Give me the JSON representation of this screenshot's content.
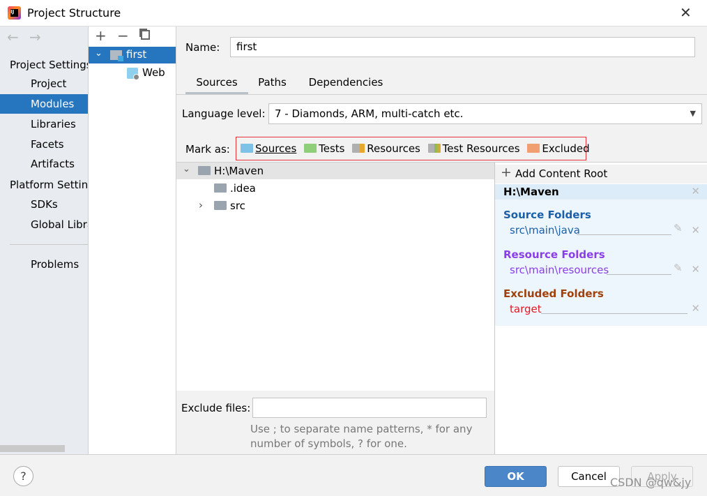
{
  "window": {
    "title": "Project Structure",
    "close_icon": "close-icon"
  },
  "sidebar": {
    "project_settings": "Project Settings",
    "items": [
      {
        "label": "Project"
      },
      {
        "label": "Modules"
      },
      {
        "label": "Libraries"
      },
      {
        "label": "Facets"
      },
      {
        "label": "Artifacts"
      }
    ],
    "platform_settings": "Platform Settings",
    "platform_items": [
      {
        "label": "SDKs"
      },
      {
        "label": "Global Libraries"
      }
    ],
    "problems": "Problems"
  },
  "modules": {
    "tree": [
      {
        "label": "first",
        "selected": true
      },
      {
        "label": "Web"
      }
    ]
  },
  "main": {
    "name_label": "Name:",
    "name_value": "first",
    "tabs": [
      {
        "label": "Sources",
        "active": true
      },
      {
        "label": "Paths"
      },
      {
        "label": "Dependencies"
      }
    ],
    "language_label": "Language level:",
    "language_value": "7 - Diamonds, ARM, multi-catch etc.",
    "mark_as_label": "Mark as:",
    "mark_as": [
      {
        "label": "Sources",
        "color": "#7ec3e6"
      },
      {
        "label": "Tests",
        "color": "#8fcf7a"
      },
      {
        "label": "Resources",
        "color": "#b0b0b0"
      },
      {
        "label": "Test Resources",
        "color": "#b0b0b0"
      },
      {
        "label": "Excluded",
        "color": "#f0a070"
      }
    ],
    "file_tree": [
      {
        "label": "H:\\Maven",
        "expanded": true
      },
      {
        "label": ".idea"
      },
      {
        "label": "src",
        "expandable": true
      }
    ],
    "exclude_label": "Exclude files:",
    "exclude_value": "",
    "hint_line1": "Use ; to separate name patterns, * for any",
    "hint_line2": "number of symbols, ? for one."
  },
  "content_root": {
    "add_label": "Add Content Root",
    "root": "H:\\Maven",
    "source_title": "Source Folders",
    "source_path": "src\\main\\java",
    "resource_title": "Resource Folders",
    "resource_path": "src\\main\\resources",
    "excluded_title": "Excluded Folders",
    "excluded_path": "target",
    "colors": {
      "source": "#1a5fa8",
      "resource": "#8a3ee8",
      "excluded": "#a0400c",
      "excluded_path": "#e8141e"
    }
  },
  "footer": {
    "ok": "OK",
    "cancel": "Cancel",
    "apply": "Apply",
    "help": "?",
    "watermark": "CSDN @qw&jy"
  }
}
